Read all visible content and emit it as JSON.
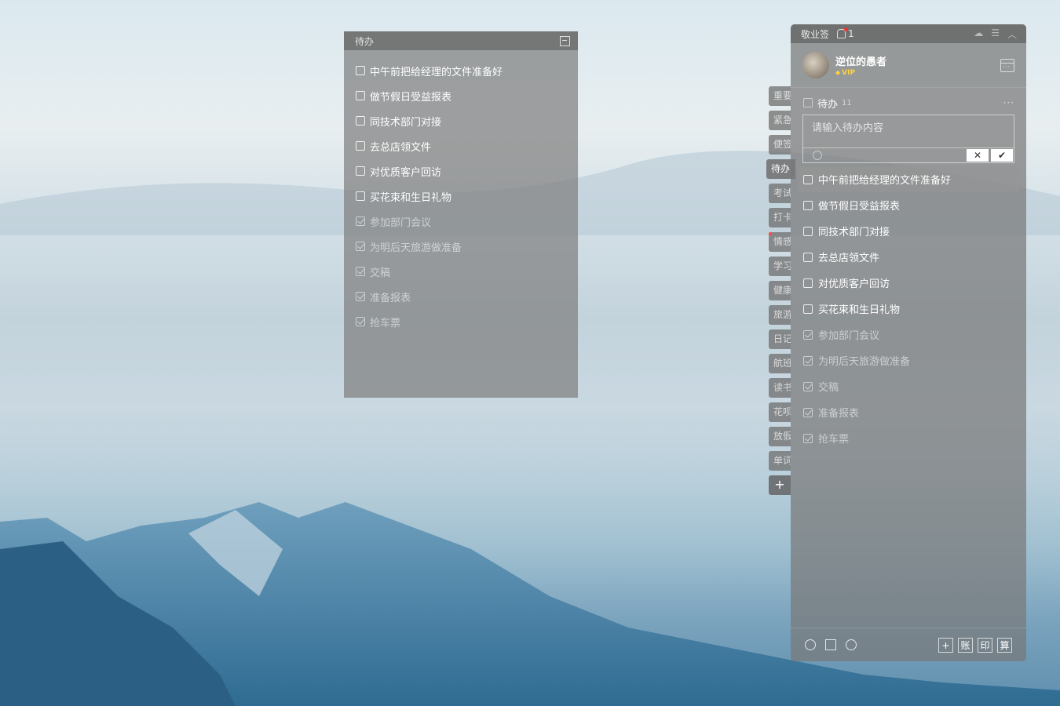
{
  "float_window": {
    "title": "待办",
    "items": [
      {
        "text": "中午前把给经理的文件准备好",
        "done": false
      },
      {
        "text": "做节假日受益报表",
        "done": false
      },
      {
        "text": "同技术部门对接",
        "done": false
      },
      {
        "text": "去总店领文件",
        "done": false
      },
      {
        "text": "对优质客户回访",
        "done": false
      },
      {
        "text": "买花束和生日礼物",
        "done": false
      },
      {
        "text": "参加部门会议",
        "done": true
      },
      {
        "text": "为明后天旅游做准备",
        "done": true
      },
      {
        "text": "交稿",
        "done": true
      },
      {
        "text": "准备报表",
        "done": true
      },
      {
        "text": "抢车票",
        "done": true
      }
    ]
  },
  "tabs": [
    "重要",
    "紧急",
    "便签",
    "待办",
    "考试",
    "打卡",
    "情感",
    "学习",
    "健康",
    "旅游",
    "日记",
    "航班",
    "读书",
    "花呗",
    "放假",
    "单词"
  ],
  "active_tab": "待办",
  "tab_add_label": "+",
  "main": {
    "app_name": "敬业签",
    "notify_count": "1",
    "user": {
      "name": "逆位的愚者",
      "badge": "VIP"
    },
    "section": {
      "title": "待办",
      "count": "11",
      "more": "···"
    },
    "input": {
      "placeholder": "请输入待办内容",
      "cancel": "✕",
      "confirm": "✔"
    },
    "items": [
      {
        "text": "中午前把给经理的文件准备好",
        "done": false
      },
      {
        "text": "做节假日受益报表",
        "done": false
      },
      {
        "text": "同技术部门对接",
        "done": false
      },
      {
        "text": "去总店领文件",
        "done": false
      },
      {
        "text": "对优质客户回访",
        "done": false
      },
      {
        "text": "买花束和生日礼物",
        "done": false
      },
      {
        "text": "参加部门会议",
        "done": true
      },
      {
        "text": "为明后天旅游做准备",
        "done": true
      },
      {
        "text": "交稿",
        "done": true
      },
      {
        "text": "准备报表",
        "done": true
      },
      {
        "text": "抢车票",
        "done": true
      }
    ],
    "footer_buttons": [
      "+",
      "账",
      "印",
      "算"
    ]
  }
}
